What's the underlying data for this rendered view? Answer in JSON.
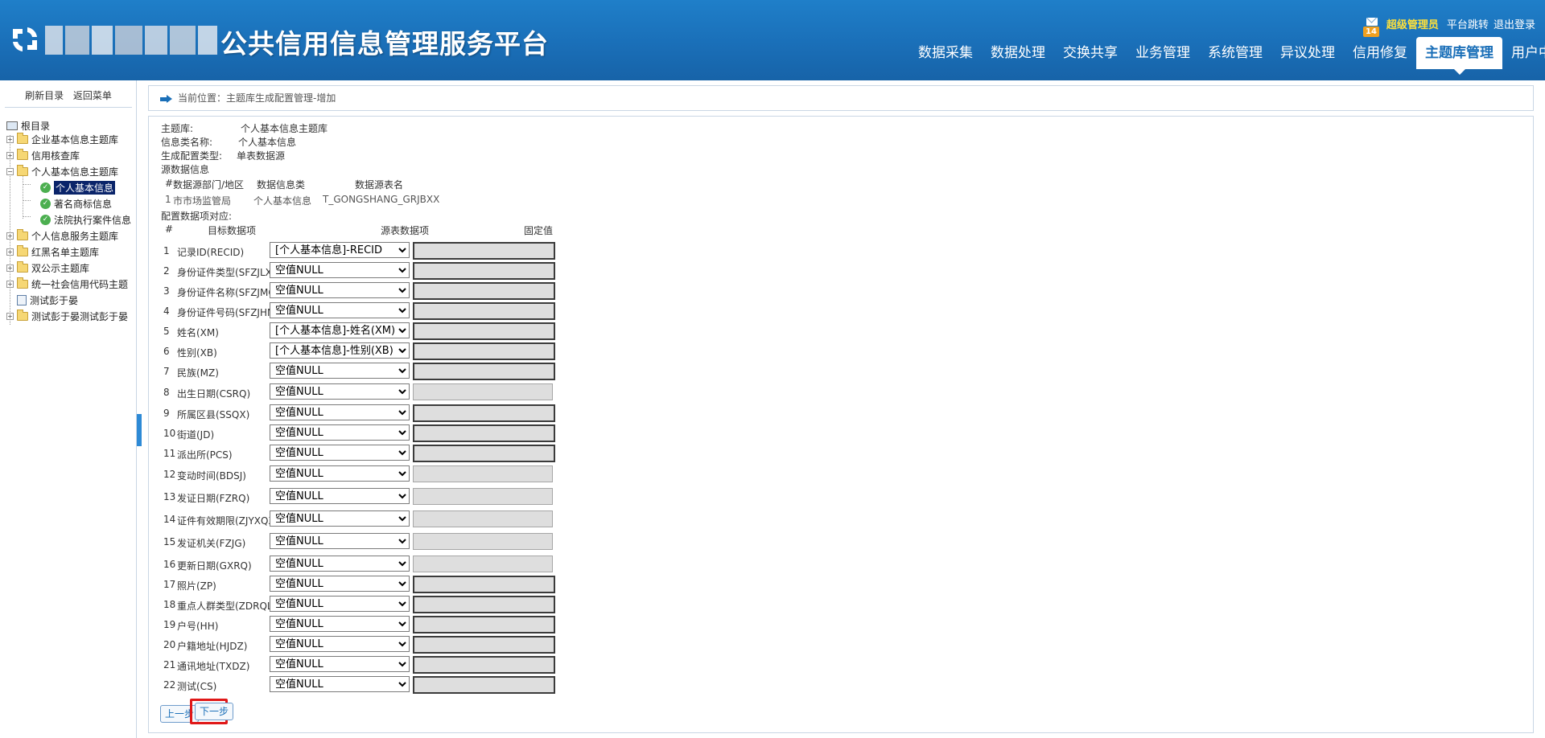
{
  "header": {
    "title": "公共信用信息管理服务平台",
    "mail_count": "14",
    "user_role": "超级管理员",
    "links": [
      "平台跳转",
      "退出登录"
    ],
    "nav": [
      "数据采集",
      "数据处理",
      "交换共享",
      "业务管理",
      "系统管理",
      "异议处理",
      "信用修复",
      "主题库管理",
      "用户中心"
    ],
    "active_nav": "主题库管理"
  },
  "sidebar": {
    "actions": [
      "刷新目录",
      "返回菜单"
    ],
    "root": "根目录",
    "nodes": [
      {
        "label": "企业基本信息主题库",
        "type": "folder",
        "level": 1,
        "expander": "+"
      },
      {
        "label": "信用核查库",
        "type": "folder",
        "level": 1,
        "expander": "+"
      },
      {
        "label": "个人基本信息主题库",
        "type": "folder",
        "level": 1,
        "expander": "-"
      },
      {
        "label": "个人基本信息",
        "type": "check",
        "level": 2,
        "expander": "",
        "selected": true
      },
      {
        "label": "著名商标信息",
        "type": "check",
        "level": 2,
        "expander": ""
      },
      {
        "label": "法院执行案件信息",
        "type": "check",
        "level": 2,
        "expander": ""
      },
      {
        "label": "个人信息服务主题库",
        "type": "folder",
        "level": 1,
        "expander": "+"
      },
      {
        "label": "红黑名单主题库",
        "type": "folder",
        "level": 1,
        "expander": "+"
      },
      {
        "label": "双公示主题库",
        "type": "folder",
        "level": 1,
        "expander": "+"
      },
      {
        "label": "统一社会信用代码主题",
        "type": "folder",
        "level": 1,
        "expander": "+"
      },
      {
        "label": "测试彭于晏",
        "type": "doc",
        "level": 1,
        "expander": ""
      },
      {
        "label": "测试彭于晏测试彭于晏",
        "type": "folder",
        "level": 1,
        "expander": "+"
      }
    ]
  },
  "breadcrumb": "当前位置：主题库生成配置管理-增加",
  "form": {
    "labels": {
      "theme": "主题库:",
      "info_type": "信息类名称:",
      "config_type": "生成配置类型:",
      "source_info": "源数据信息",
      "mapping": "配置数据项对应:"
    },
    "values": {
      "theme": "个人基本信息主题库",
      "info_type": "个人基本信息",
      "config_type": "单表数据源"
    },
    "source_header": [
      "#",
      "数据源部门/地区",
      "数据信息类",
      "数据源表名"
    ],
    "source_rows": [
      {
        "num": "1",
        "dept": "市市场监管局",
        "info": "个人基本信息",
        "table": "T_GONGSHANG_GRJBXX"
      }
    ],
    "mapping_header": [
      "#",
      "目标数据项",
      "源表数据项",
      "固定值"
    ],
    "mapping_rows": [
      {
        "num": "1",
        "target": "记录ID(RECID)",
        "source": "[个人基本信息]-RECID",
        "fixed_style": "dark"
      },
      {
        "num": "2",
        "target": "身份证件类型(SFZJLX)",
        "source": "空值NULL",
        "fixed_style": "dark"
      },
      {
        "num": "3",
        "target": "身份证件名称(SFZJMC)",
        "source": "空值NULL",
        "fixed_style": "dark"
      },
      {
        "num": "4",
        "target": "身份证件号码(SFZJHM)",
        "source": "空值NULL",
        "fixed_style": "dark"
      },
      {
        "num": "5",
        "target": "姓名(XM)",
        "source": "[个人基本信息]-姓名(XM)",
        "fixed_style": "dark"
      },
      {
        "num": "6",
        "target": "性别(XB)",
        "source": "[个人基本信息]-性别(XB)",
        "fixed_style": "dark"
      },
      {
        "num": "7",
        "target": "民族(MZ)",
        "source": "空值NULL",
        "fixed_style": "dark"
      },
      {
        "num": "8",
        "target": "出生日期(CSRQ)",
        "source": "空值NULL",
        "fixed_style": "light"
      },
      {
        "num": "9",
        "target": "所属区县(SSQX)",
        "source": "空值NULL",
        "fixed_style": "dark"
      },
      {
        "num": "10",
        "target": "街道(JD)",
        "source": "空值NULL",
        "fixed_style": "dark"
      },
      {
        "num": "11",
        "target": "派出所(PCS)",
        "source": "空值NULL",
        "fixed_style": "dark"
      },
      {
        "num": "12",
        "target": "变动时间(BDSJ)",
        "source": "空值NULL",
        "fixed_style": "light"
      },
      {
        "num": "13",
        "target": "发证日期(FZRQ)",
        "source": "空值NULL",
        "fixed_style": "light"
      },
      {
        "num": "14",
        "target": "证件有效期限(ZJYXQX)",
        "source": "空值NULL",
        "fixed_style": "light"
      },
      {
        "num": "15",
        "target": "发证机关(FZJG)",
        "source": "空值NULL",
        "fixed_style": "light"
      },
      {
        "num": "16",
        "target": "更新日期(GXRQ)",
        "source": "空值NULL",
        "fixed_style": "light"
      },
      {
        "num": "17",
        "target": "照片(ZP)",
        "source": "空值NULL",
        "fixed_style": "dark"
      },
      {
        "num": "18",
        "target": "重点人群类型(ZDRQLX)",
        "source": "空值NULL",
        "fixed_style": "dark"
      },
      {
        "num": "19",
        "target": "户号(HH)",
        "source": "空值NULL",
        "fixed_style": "dark"
      },
      {
        "num": "20",
        "target": "户籍地址(HJDZ)",
        "source": "空值NULL",
        "fixed_style": "dark"
      },
      {
        "num": "21",
        "target": "通讯地址(TXDZ)",
        "source": "空值NULL",
        "fixed_style": "dark"
      },
      {
        "num": "22",
        "target": "测试(CS)",
        "source": "空值NULL",
        "fixed_style": "dark"
      }
    ],
    "buttons": {
      "prev": "上一步",
      "next": "下一步"
    }
  },
  "colors": {
    "header": "#1a6fb8",
    "highlight": "#e01818",
    "admin": "#ffe13a",
    "badge": "#f0a020"
  },
  "icons": [
    "logo-icon",
    "mail-icon",
    "arrow-right-icon",
    "folder-icon",
    "check-circle-icon",
    "computer-icon",
    "document-icon"
  ]
}
